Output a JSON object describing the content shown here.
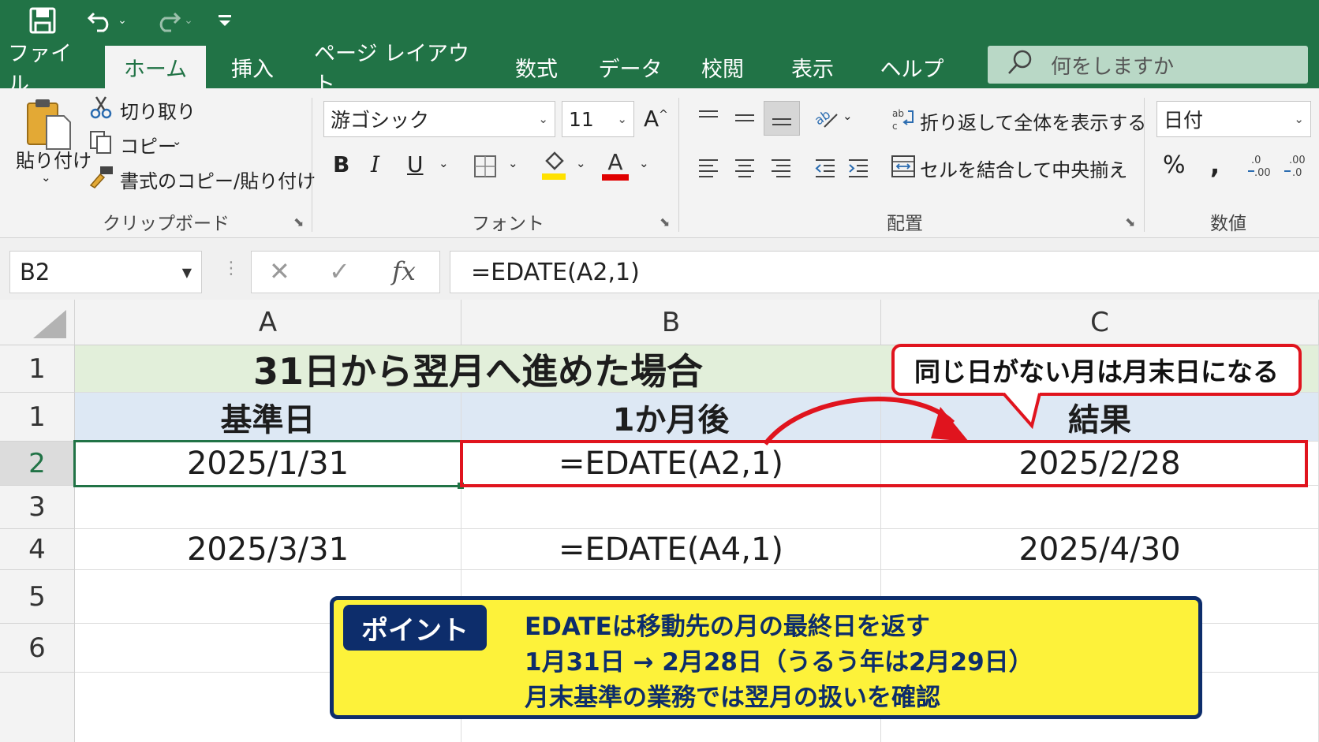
{
  "qat": {
    "save_icon": "save-icon",
    "undo_icon": "undo-icon",
    "redo_icon": "redo-icon",
    "customize_icon": "customize-qat-icon"
  },
  "tabs": [
    {
      "label": "ファイル"
    },
    {
      "label": "ホーム"
    },
    {
      "label": "挿入"
    },
    {
      "label": "ページ レイアウト"
    },
    {
      "label": "数式"
    },
    {
      "label": "データ"
    },
    {
      "label": "校閲"
    },
    {
      "label": "表示"
    },
    {
      "label": "ヘルプ"
    }
  ],
  "tellme": {
    "placeholder": "何をしますか"
  },
  "clipboard": {
    "paste": "貼り付け",
    "cut": "切り取り",
    "copy": "コピー",
    "format_painter": "書式のコピー/貼り付け",
    "group": "クリップボード"
  },
  "font": {
    "name": "游ゴシック",
    "size": "11",
    "bold": "B",
    "italic": "I",
    "underline": "U",
    "font_color_letter": "A",
    "grow_letter": "A",
    "group": "フォント",
    "highlight_color": "#ffe100",
    "font_color": "#e00000"
  },
  "alignment": {
    "wrap_text": "折り返して全体を表示する",
    "merge_center": "セルを結合して中央揃え",
    "group": "配置"
  },
  "number": {
    "format": "日付",
    "percent": "%",
    "comma": "❜",
    "inc_decimal": "←0\n.00",
    "dec_decimal": ".00\n→.0",
    "group": "数値"
  },
  "formula_bar": {
    "name_box": "B2",
    "cancel": "✕",
    "enter": "✓",
    "fx": "fx",
    "formula": "=EDATE(A2,1)"
  },
  "columns": [
    "A",
    "B",
    "C"
  ],
  "rows": [
    {
      "header": "1",
      "title": "31日から翌月へ進めた場合"
    },
    {
      "header": "1",
      "cells": [
        "基準日",
        "1か月後",
        "結果"
      ]
    },
    {
      "header": "2",
      "cells": [
        "2025/1/31",
        "=EDATE(A2,1)",
        "2025/2/28"
      ]
    },
    {
      "header": "3",
      "cells": [
        "",
        "",
        ""
      ]
    },
    {
      "header": "4",
      "cells": [
        "2025/3/31",
        "=EDATE(A4,1)",
        "2025/4/30"
      ]
    },
    {
      "header": "5",
      "cells": [
        "",
        "",
        ""
      ]
    },
    {
      "header": "6",
      "cells": [
        "",
        "",
        ""
      ]
    }
  ],
  "callout": {
    "text": "同じ日がない月は月末日になる"
  },
  "point_box": {
    "tag": "ポイント",
    "lines": [
      "EDATEは移動先の月の最終日を返す",
      "1月31日 → 2月28日（うるう年は2月29日）",
      "月末基準の業務では翌月の扱いを確認"
    ]
  },
  "colors": {
    "excel_green": "#217346",
    "highlight_red": "#e0141e",
    "point_yellow": "#fdf23a",
    "point_navy": "#0d2d6b"
  }
}
